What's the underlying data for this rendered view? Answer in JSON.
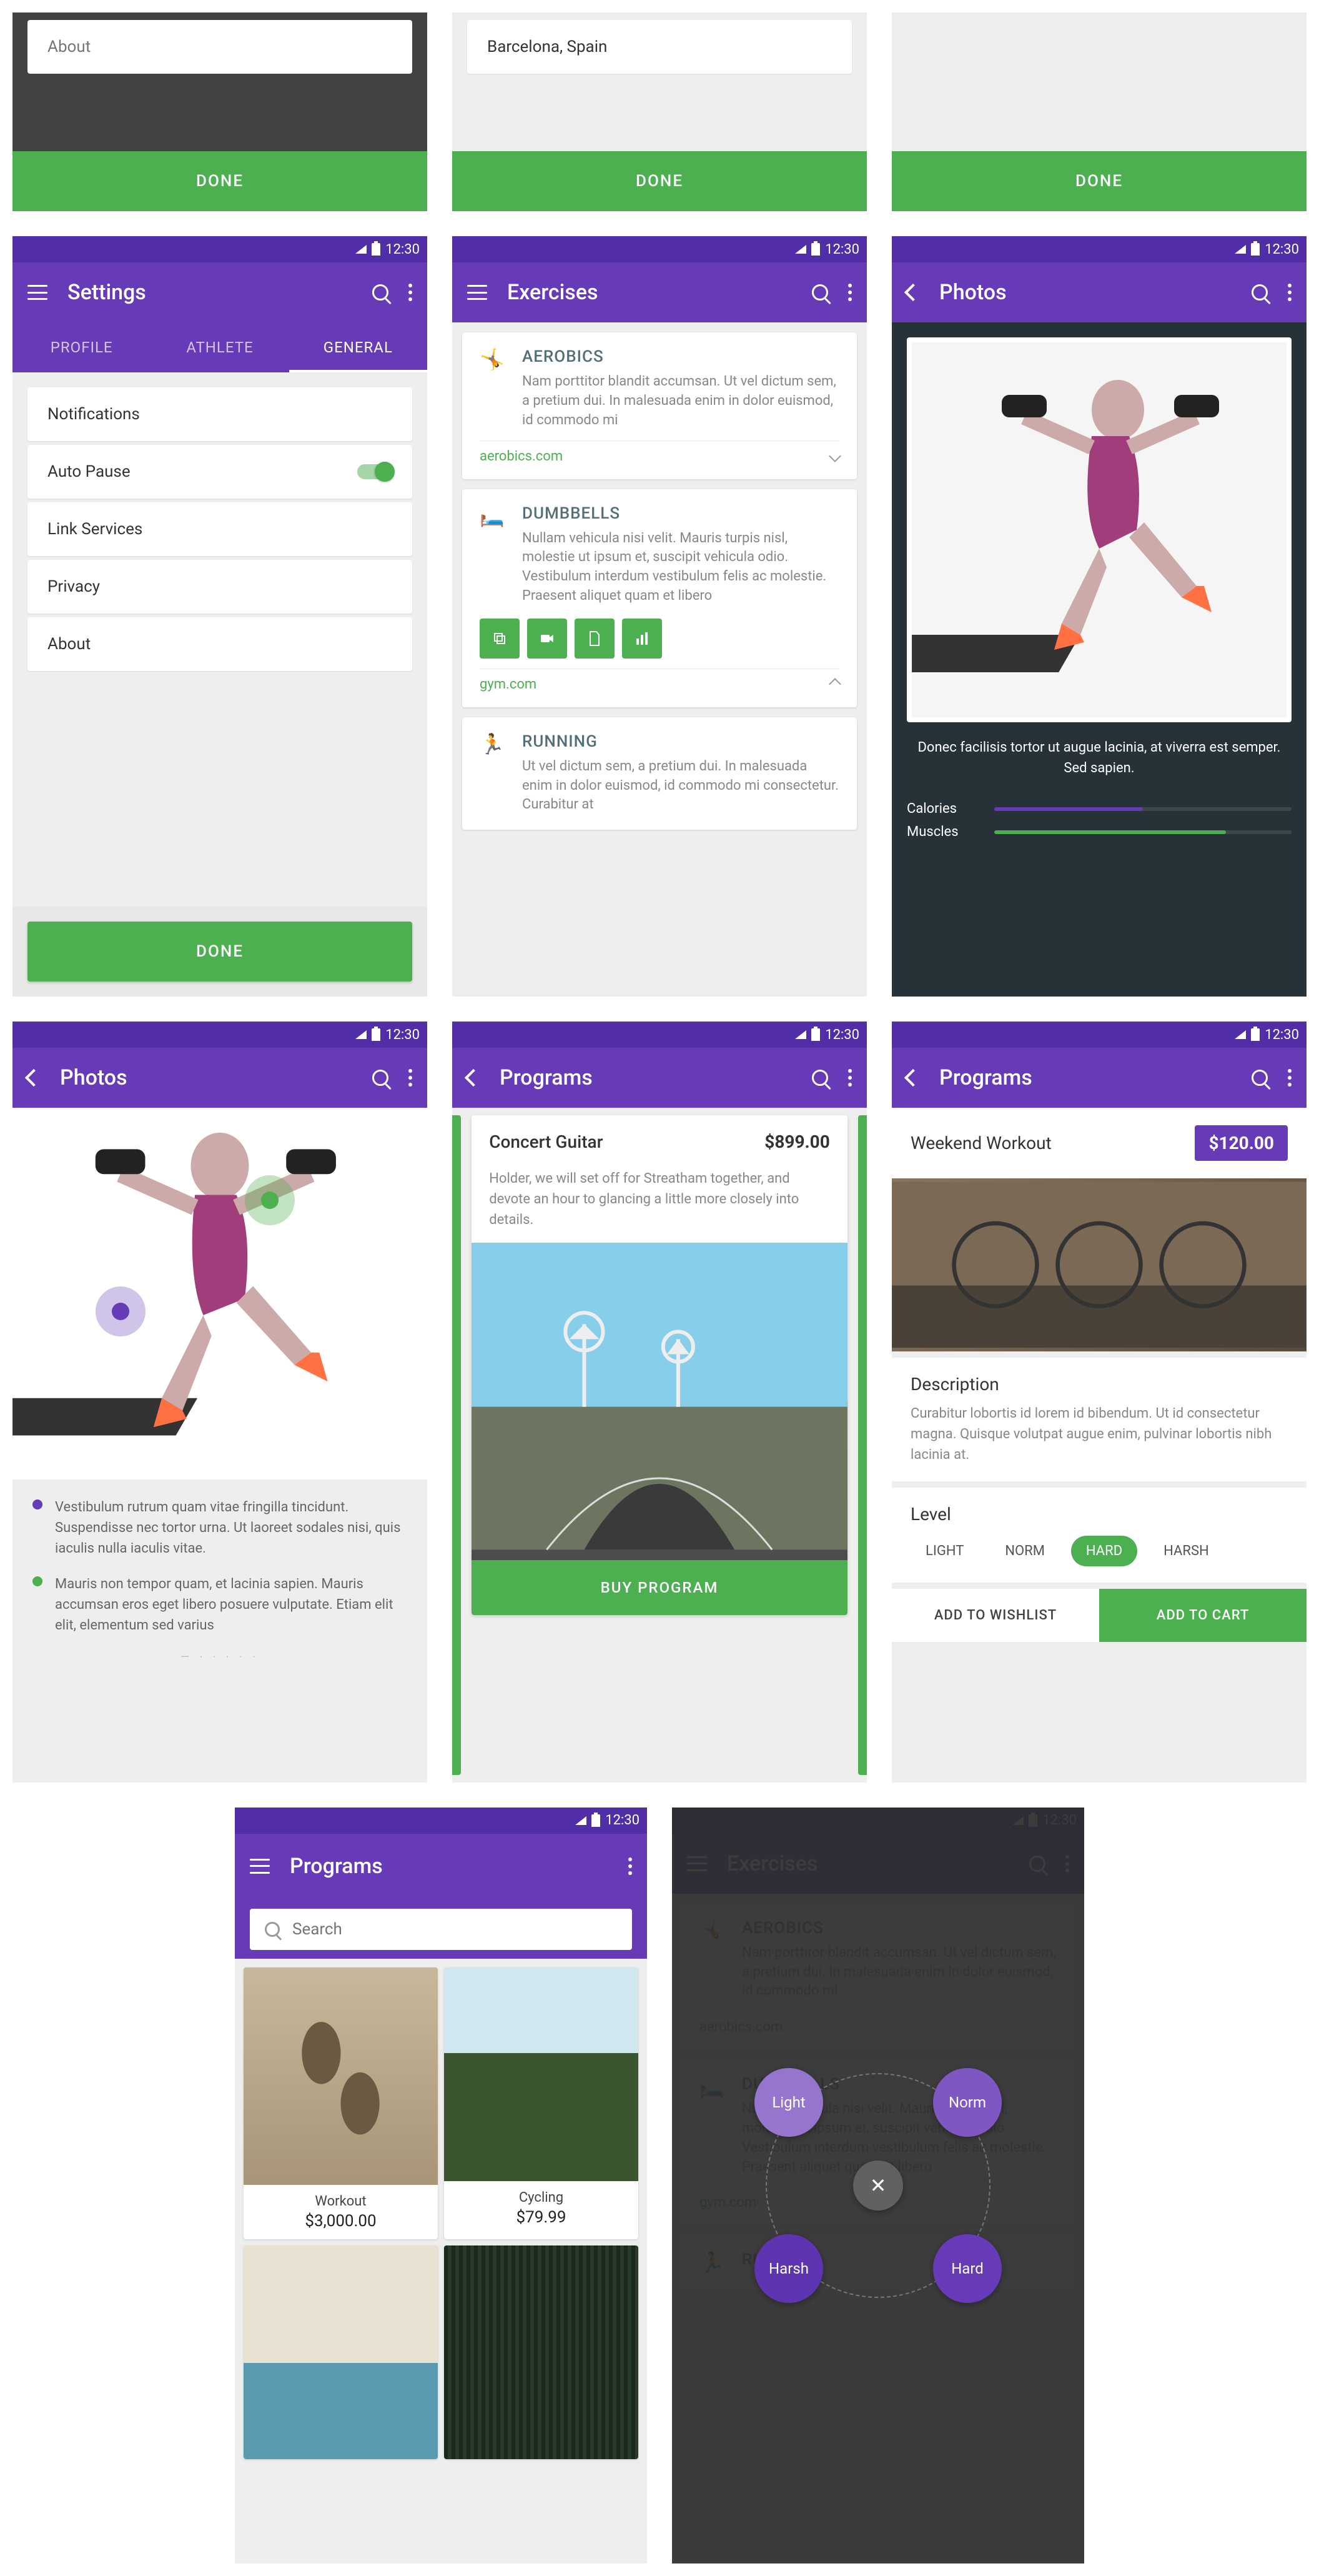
{
  "status_time": "12:30",
  "done_label": "DONE",
  "row1": {
    "s1_about": "About",
    "s2_location": "Barcelona, Spain"
  },
  "settings": {
    "title": "Settings",
    "tabs": [
      "PROFILE",
      "ATHLETE",
      "GENERAL"
    ],
    "items": [
      "Notifications",
      "Auto Pause",
      "Link Services",
      "Privacy",
      "About"
    ]
  },
  "exercises": {
    "title": "Exercises",
    "items": [
      {
        "title": "AEROBICS",
        "desc": "Nam porttitor blandit accumsan. Ut vel dictum sem, a pretium dui. In malesuada enim in dolor euismod, id commodo mi",
        "link": "aerobics.com"
      },
      {
        "title": "DUMBBELLS",
        "desc": "Nullam vehicula nisi velit. Mauris turpis nisl, molestie ut ipsum et, suscipit vehicula odio. Vestibulum interdum vestibulum felis ac molestie. Praesent aliquet quam et libero",
        "link": "gym.com"
      },
      {
        "title": "RUNNING",
        "desc": "Ut vel dictum sem, a pretium dui. In malesuada enim in dolor euismod, id commodo mi consectetur. Curabitur at"
      }
    ]
  },
  "photos": {
    "title": "Photos",
    "caption": "Donec facilisis tortor ut augue lacinia, at viverra est semper. Sed sapien.",
    "meters": [
      {
        "label": "Calories",
        "color": "#673ab7",
        "pct": 50
      },
      {
        "label": "Muscles",
        "color": "#4caf50",
        "pct": 78
      }
    ],
    "notes": [
      {
        "color": "#673ab7",
        "text": "Vestibulum rutrum quam vitae fringilla tincidunt. Suspendisse nec tortor urna. Ut laoreet sodales nisi, quis iaculis nulla iaculis vitae."
      },
      {
        "color": "#4caf50",
        "text": "Mauris non tempor quam, et lacinia sapien. Mauris accumsan eros eget libero posuere vulputate. Etiam elit elit, elementum sed varius"
      }
    ]
  },
  "program_card": {
    "title": "Programs",
    "name": "Concert Guitar",
    "price": "$899.00",
    "desc": "Holder, we will set off for Streatham together, and devote an hour to glancing a little more closely into details.",
    "buy": "BUY PROGRAM"
  },
  "program_detail": {
    "title": "Programs",
    "name": "Weekend Workout",
    "price": "$120.00",
    "desc_head": "Description",
    "desc": "Curabitur lobortis id lorem id bibendum. Ut id consectetur magna. Quisque volutpat augue enim, pulvinar lobortis nibh lacinia at.",
    "level_head": "Level",
    "levels": [
      "LIGHT",
      "NORM",
      "HARD",
      "HARSH"
    ],
    "wishlist": "ADD TO WISHLIST",
    "cart": "ADD TO CART"
  },
  "program_grid": {
    "title": "Programs",
    "search_placeholder": "Search",
    "items": [
      {
        "name": "Workout",
        "price": "$3,000.00"
      },
      {
        "name": "Cycling",
        "price": "$79.99"
      }
    ]
  },
  "filter": {
    "options": [
      "Light",
      "Norm",
      "Harsh",
      "Hard"
    ],
    "close": "✕"
  }
}
